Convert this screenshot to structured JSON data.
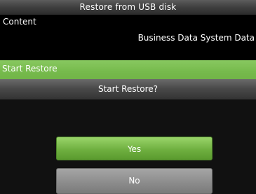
{
  "window": {
    "title": "Restore from USB disk"
  },
  "content": {
    "label": "Content",
    "value": "Business Data System Data"
  },
  "menu": {
    "selected_item": "Start Restore"
  },
  "dialog": {
    "prompt": "Start Restore?",
    "yes_label": "Yes",
    "no_label": "No"
  },
  "colors": {
    "highlight": "#76ba4c",
    "title_bar": "#3e3e3e",
    "yes_button": "#6fb040",
    "no_button": "#8d8d8d",
    "background": "#000000"
  }
}
